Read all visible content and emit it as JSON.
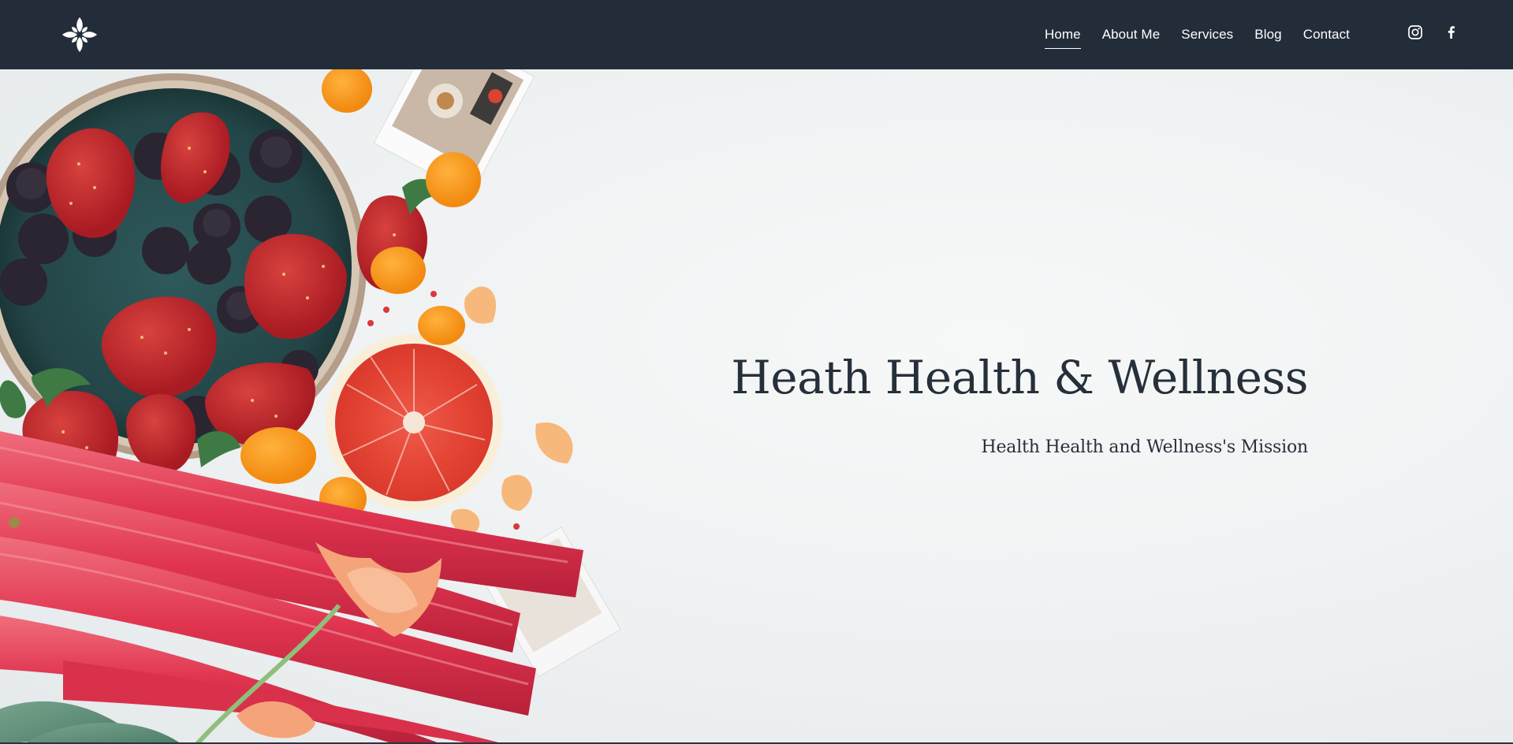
{
  "header": {
    "logo_icon": "flower-icon",
    "nav": [
      {
        "label": "Home",
        "active": true
      },
      {
        "label": "About Me",
        "active": false
      },
      {
        "label": "Services",
        "active": false
      },
      {
        "label": "Blog",
        "active": false
      },
      {
        "label": "Contact",
        "active": false
      }
    ],
    "social": [
      {
        "icon": "instagram-icon"
      },
      {
        "icon": "facebook-icon"
      }
    ],
    "background_color": "#232d3a",
    "text_color": "#ffffff"
  },
  "hero": {
    "title": "Heath Health & Wellness",
    "subtitle": "Health Health and Wellness's Mission",
    "text_color": "#26303a",
    "image_subject": "fruit-and-rhubarb-photo"
  }
}
